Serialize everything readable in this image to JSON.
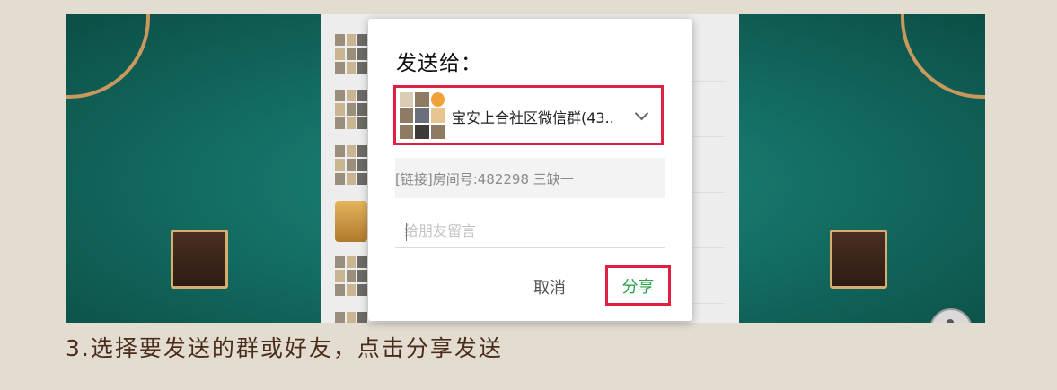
{
  "dialog": {
    "title": "发送给：",
    "recipient_name": "宝安上合社区微信群(43..",
    "link_text": "[链接]房间号:482298  三缺一",
    "message_placeholder": "给朋友留言",
    "cancel_label": "取消",
    "share_label": "分享"
  },
  "caption": "3.选择要发送的群或好友，点击分享发送",
  "colors": {
    "highlight": "#e02040",
    "share_text": "#2ba245",
    "caption_text": "#4b2c1a"
  }
}
